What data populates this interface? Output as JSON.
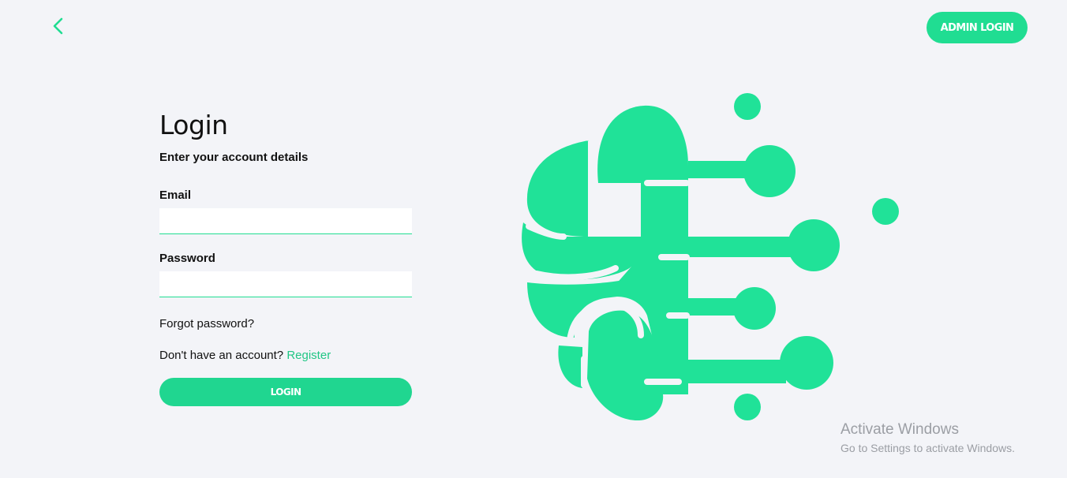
{
  "header": {
    "back_icon": "chevron-left-icon",
    "admin_login_label": "ADMIN LOGIN"
  },
  "login": {
    "title": "Login",
    "subtitle": "Enter your account details",
    "email_label": "Email",
    "email_value": "",
    "password_label": "Password",
    "password_value": "",
    "forgot_password": "Forgot password?",
    "no_account_text": "Don't have an account?",
    "register_link": "Register",
    "login_button": "LOGIN"
  },
  "illustration": {
    "icon": "brain-circuit-icon"
  },
  "watermark": {
    "title": "Activate Windows",
    "subtitle": "Go to Settings to activate Windows."
  },
  "colors": {
    "accent": "#20dd92",
    "background": "#f3f4f8",
    "text": "#111111",
    "watermark": "#9b9ea4"
  }
}
